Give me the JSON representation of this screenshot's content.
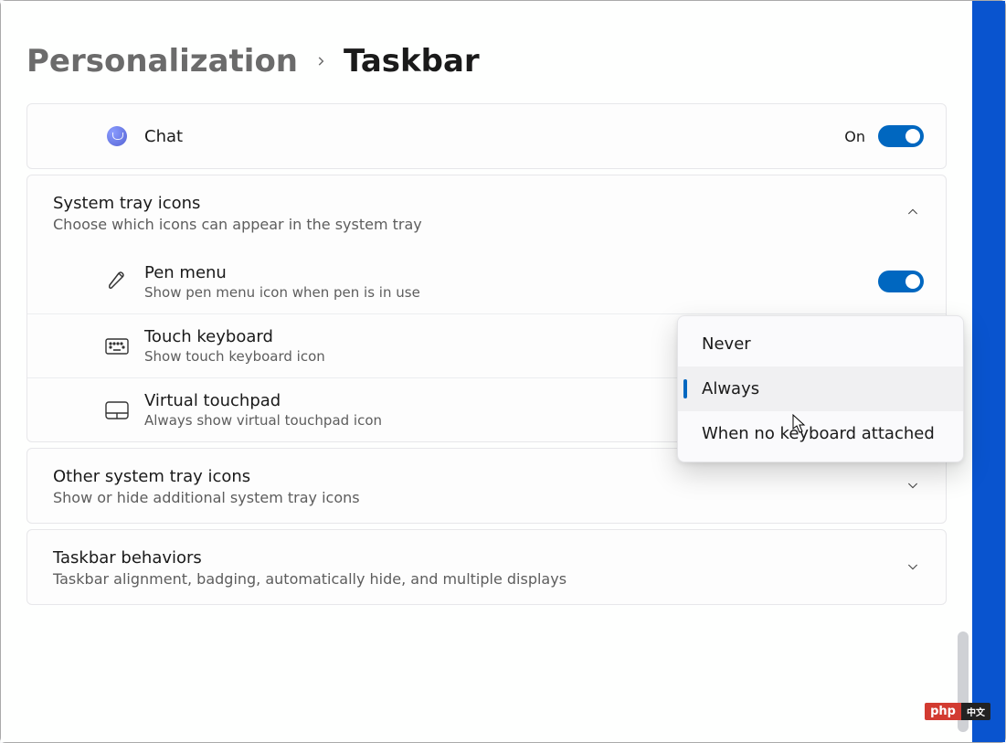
{
  "breadcrumb": {
    "parent": "Personalization",
    "current": "Taskbar"
  },
  "chat": {
    "label": "Chat",
    "state": "On",
    "on": true
  },
  "section_tray": {
    "title": "System tray icons",
    "subtitle": "Choose which icons can appear in the system tray"
  },
  "pen": {
    "title": "Pen menu",
    "subtitle": "Show pen menu icon when pen is in use"
  },
  "touch_kb": {
    "title": "Touch keyboard",
    "subtitle": "Show touch keyboard icon"
  },
  "touchpad": {
    "title": "Virtual touchpad",
    "subtitle": "Always show virtual touchpad icon"
  },
  "section_other": {
    "title": "Other system tray icons",
    "subtitle": "Show or hide additional system tray icons"
  },
  "section_behav": {
    "title": "Taskbar behaviors",
    "subtitle": "Taskbar alignment, badging, automatically hide, and multiple displays"
  },
  "dropdown": {
    "options": [
      "Never",
      "Always",
      "When no keyboard attached"
    ],
    "selected_index": 1
  },
  "watermark": {
    "left": "php",
    "right": "中文"
  }
}
